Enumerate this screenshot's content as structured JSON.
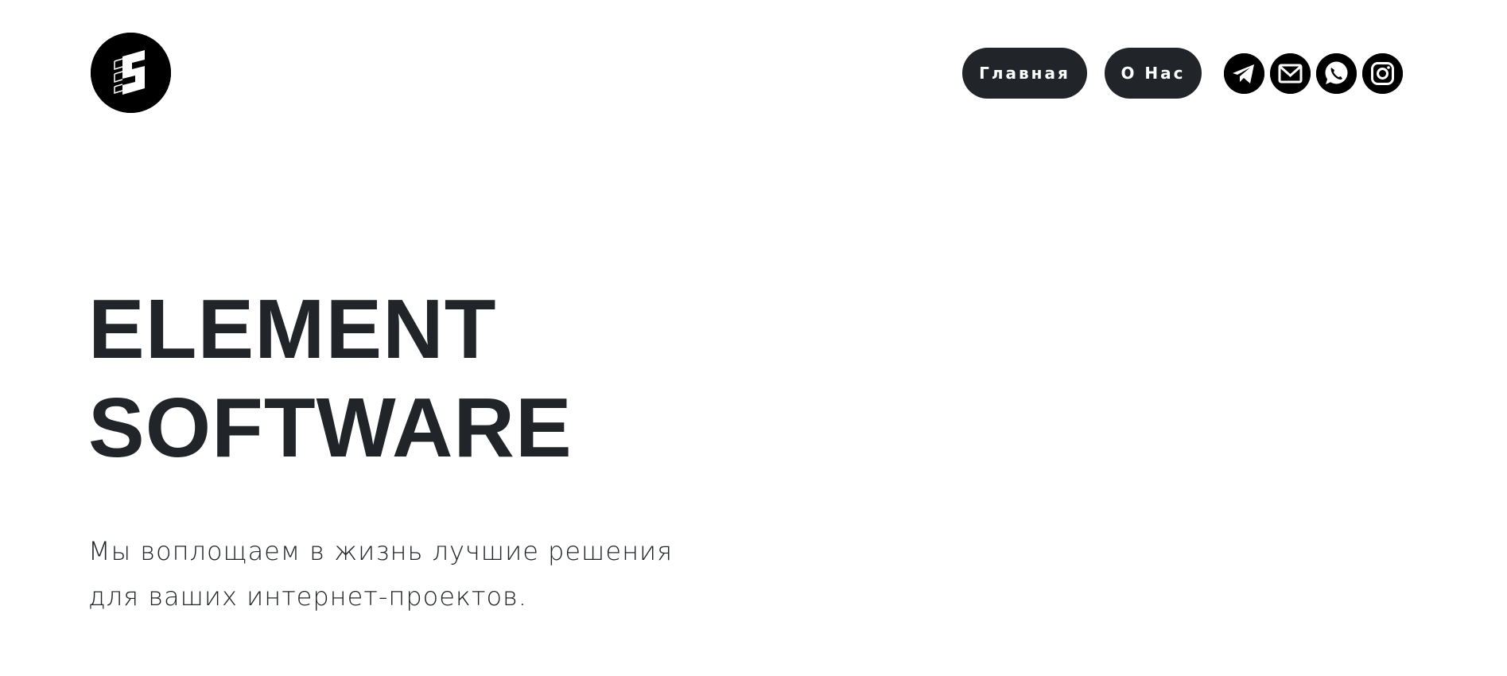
{
  "header": {
    "logo_icon": "element-software-s-logo-icon",
    "nav": [
      {
        "label": "Главная"
      },
      {
        "label": "О Нас"
      }
    ],
    "socials": [
      {
        "icon": "telegram-icon"
      },
      {
        "icon": "mail-icon"
      },
      {
        "icon": "whatsapp-icon"
      },
      {
        "icon": "instagram-icon"
      }
    ]
  },
  "hero": {
    "title_line1": "ELEMENT",
    "title_line2": "SOFTWARE",
    "subtitle_line1": "Мы воплощаем в жизнь лучшие решения",
    "subtitle_line2": "для ваших интернет-проектов."
  },
  "colors": {
    "background": "#ffffff",
    "dark": "#212529",
    "icon_bg": "#000000"
  }
}
